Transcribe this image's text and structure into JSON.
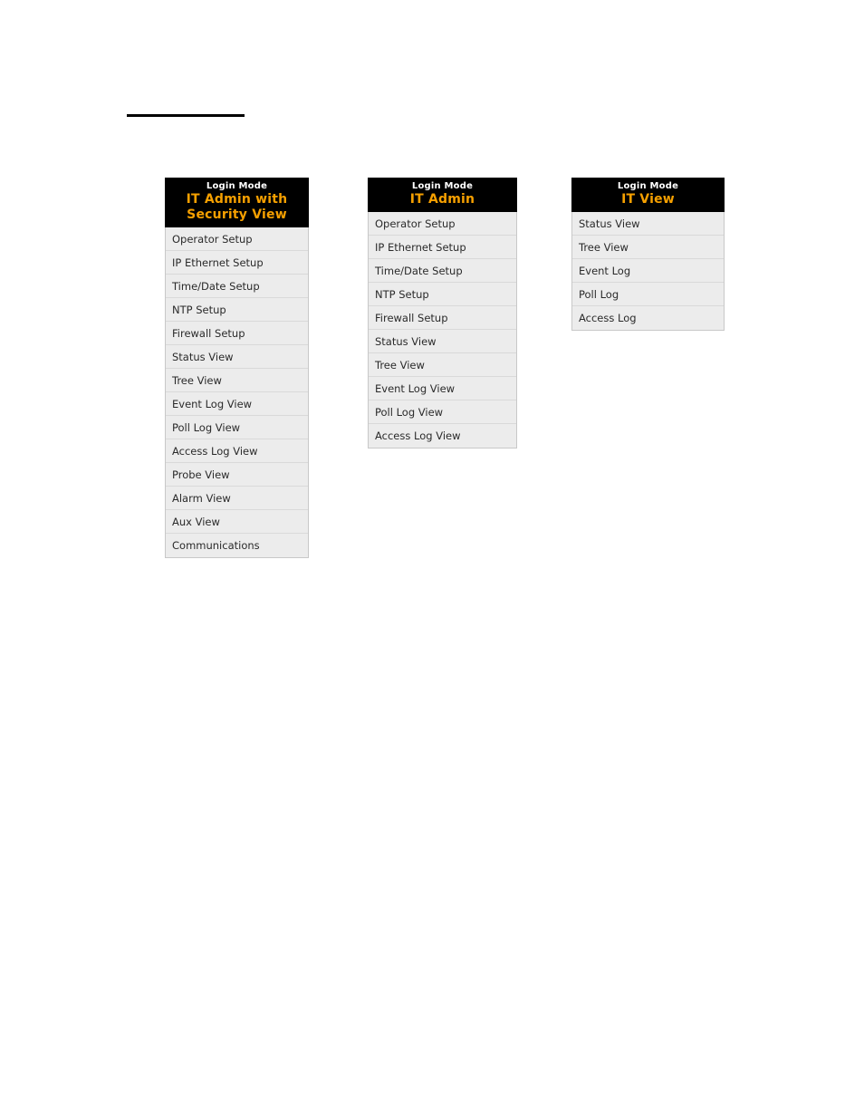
{
  "page": {
    "background_color": "#ffffff",
    "rule_color": "#000000"
  },
  "theme": {
    "header_background": "#000000",
    "header_label_color": "#ffffff",
    "mode_name_color": "#f6a000",
    "item_background": "#ececec",
    "item_text_color": "#2a2a2a",
    "item_divider_color": "#d9d9d9",
    "panel_border_color": "#c8c8c8"
  },
  "menus": [
    {
      "header_label": "Login Mode",
      "mode_name": "IT Admin with\nSecurity View",
      "items": [
        {
          "label": "Operator Setup"
        },
        {
          "label": "IP Ethernet Setup"
        },
        {
          "label": "Time/Date Setup"
        },
        {
          "label": "NTP Setup"
        },
        {
          "label": "Firewall Setup"
        },
        {
          "label": "Status View"
        },
        {
          "label": "Tree View"
        },
        {
          "label": "Event Log View"
        },
        {
          "label": "Poll Log View"
        },
        {
          "label": "Access Log View"
        },
        {
          "label": "Probe View"
        },
        {
          "label": "Alarm View"
        },
        {
          "label": "Aux View"
        },
        {
          "label": "Communications"
        }
      ]
    },
    {
      "header_label": "Login Mode",
      "mode_name": "IT Admin",
      "items": [
        {
          "label": "Operator Setup"
        },
        {
          "label": "IP Ethernet Setup"
        },
        {
          "label": "Time/Date Setup"
        },
        {
          "label": "NTP Setup"
        },
        {
          "label": "Firewall Setup"
        },
        {
          "label": "Status View"
        },
        {
          "label": "Tree View"
        },
        {
          "label": "Event Log View"
        },
        {
          "label": "Poll Log View"
        },
        {
          "label": "Access Log View"
        }
      ]
    },
    {
      "header_label": "Login Mode",
      "mode_name": "IT View",
      "items": [
        {
          "label": "Status View"
        },
        {
          "label": "Tree View"
        },
        {
          "label": "Event Log"
        },
        {
          "label": "Poll Log"
        },
        {
          "label": "Access Log"
        }
      ]
    }
  ]
}
